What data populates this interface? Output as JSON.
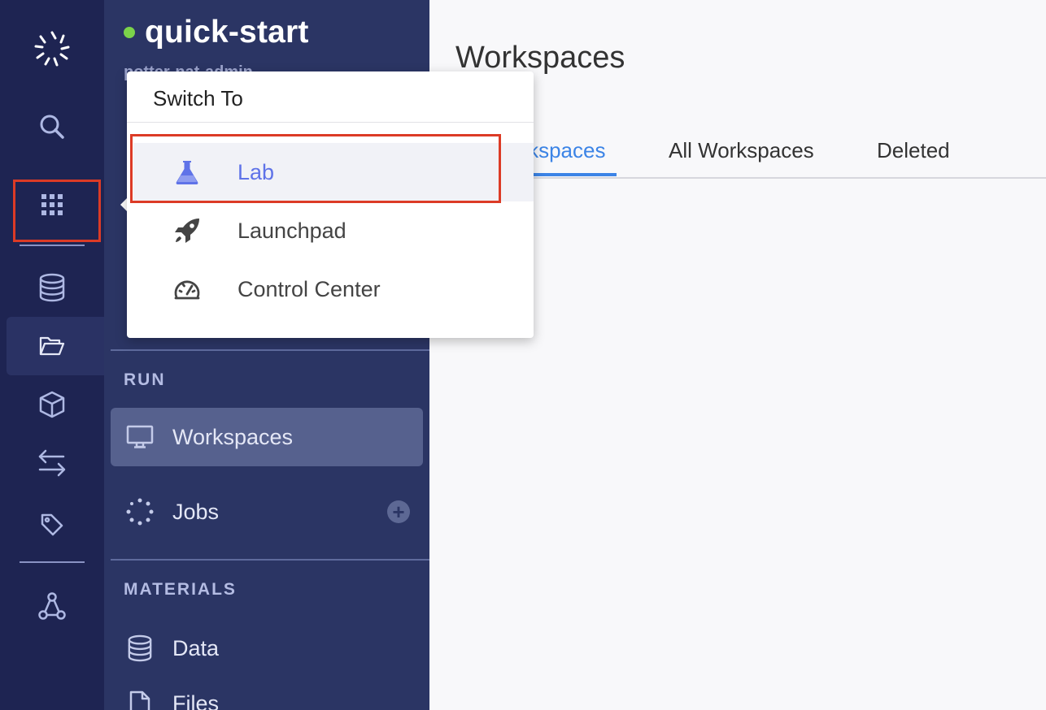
{
  "rail": {
    "icons": [
      "logo-icon",
      "search-icon",
      "apps-grid-icon",
      "database-icon",
      "folder-open-icon",
      "cube-icon",
      "transfer-icon",
      "tag-icon",
      "network-icon"
    ]
  },
  "sidebar": {
    "project_name": "quick-start",
    "owner": "potter-nat-admin",
    "run_section": "RUN",
    "run_items": [
      {
        "label": "Workspaces",
        "icon": "monitor-icon"
      },
      {
        "label": "Jobs",
        "icon": "jobs-icon"
      }
    ],
    "materials_section": "MATERIALS",
    "material_items": [
      {
        "label": "Data",
        "icon": "database-icon"
      },
      {
        "label": "Files",
        "icon": "file-icon"
      }
    ],
    "add_symbol": "+"
  },
  "main": {
    "title": "Workspaces",
    "tabs": [
      {
        "label": "My Workspaces",
        "active": true
      },
      {
        "label": "All Workspaces",
        "active": false
      },
      {
        "label": "Deleted",
        "active": false
      }
    ]
  },
  "switch_menu": {
    "title": "Switch To",
    "items": [
      {
        "label": "Lab",
        "icon": "flask-icon",
        "selected": true
      },
      {
        "label": "Launchpad",
        "icon": "rocket-icon",
        "selected": false
      },
      {
        "label": "Control Center",
        "icon": "speedometer-icon",
        "selected": false
      }
    ]
  },
  "colors": {
    "rail_bg": "#1e2452",
    "sidebar_bg": "#2b3564",
    "accent_blue": "#3c84e6",
    "lab_accent": "#5f73e8",
    "highlight_red": "#dc3b26",
    "status_green": "#7bd34a"
  }
}
